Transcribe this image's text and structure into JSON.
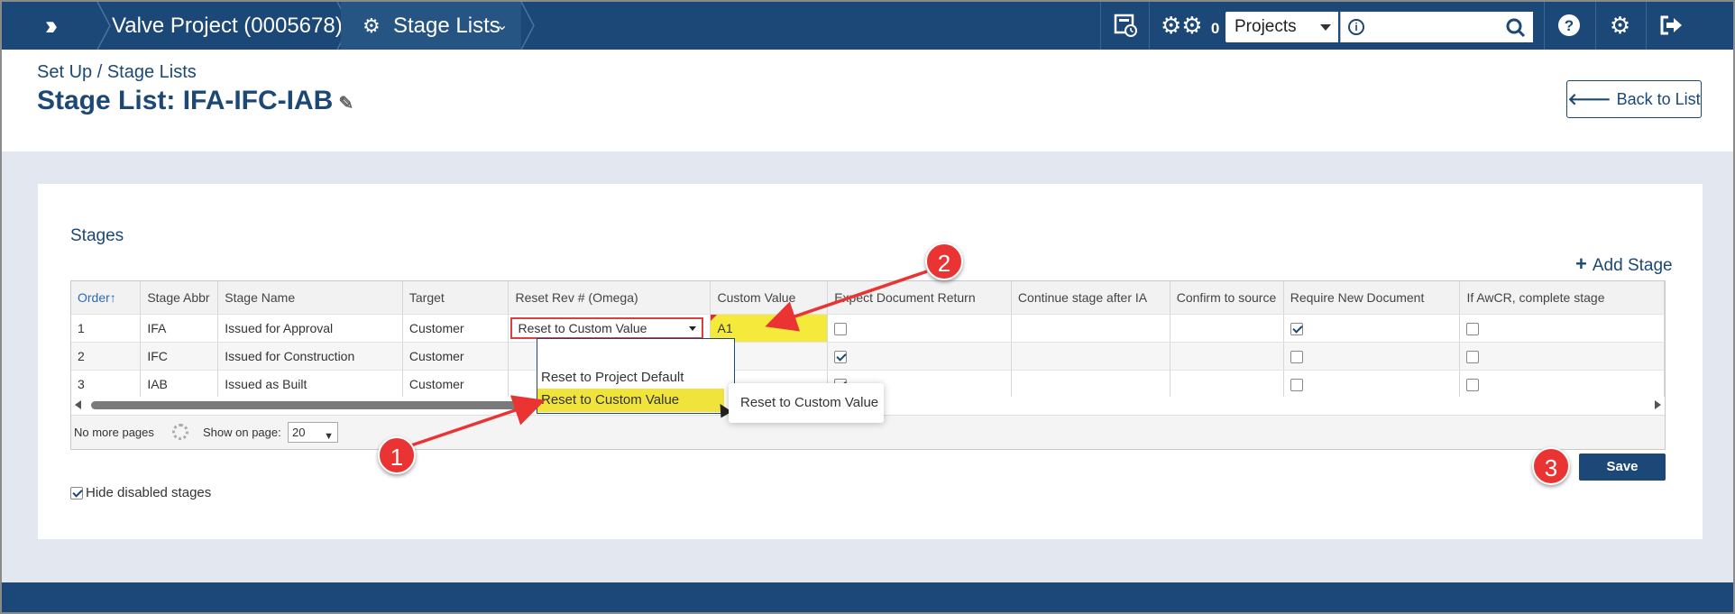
{
  "topbar": {
    "project_crumb": "Valve Project (0005678)",
    "stage_crumb": "Stage Lists",
    "jobs_count": "0",
    "scope_select": "Projects",
    "search_placeholder": ""
  },
  "header": {
    "breadcrumb": "Set Up / Stage Lists",
    "title": "Stage List: IFA-IFC-IAB",
    "back_button": "Back to List"
  },
  "panel": {
    "section_title": "Stages",
    "add_stage": "Add Stage",
    "columns": [
      "Order",
      "Stage Abbr",
      "Stage Name",
      "Target",
      "Reset Rev # (Omega)",
      "Custom Value",
      "Expect Document Return",
      "Continue stage after IA",
      "Confirm to source",
      "Require New Document",
      "If AwCR, complete stage"
    ],
    "order_sort_icon": "↑",
    "rows": [
      {
        "order": "1",
        "abbr": "IFA",
        "name": "Issued for Approval",
        "target": "Customer",
        "reset": "Reset to Custom Value",
        "custom": "A1",
        "expect": false,
        "require": true,
        "awcr": false
      },
      {
        "order": "2",
        "abbr": "IFC",
        "name": "Issued for Construction",
        "target": "Customer",
        "reset": "",
        "custom": "",
        "expect": true,
        "require": false,
        "awcr": false
      },
      {
        "order": "3",
        "abbr": "IAB",
        "name": "Issued as Built",
        "target": "Customer",
        "reset": "",
        "custom": "",
        "expect": true,
        "require": false,
        "awcr": false
      }
    ],
    "dropdown_options": [
      "Reset to Project Default",
      "Reset to Custom Value"
    ],
    "tooltip": "Reset to Custom Value",
    "pager": {
      "no_more": "No more pages",
      "show_on_page": "Show on page:",
      "page_size": "20"
    },
    "save": "Save",
    "hide_disabled": "Hide disabled stages"
  },
  "callouts": [
    "1",
    "2",
    "3"
  ],
  "colors": {
    "nav": "#1b4876",
    "highlight": "#f5ea3b",
    "callout": "#ea3434"
  }
}
